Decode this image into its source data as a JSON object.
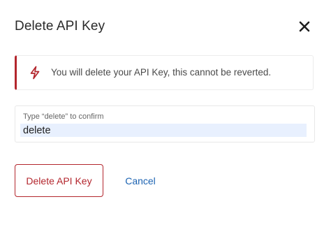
{
  "dialog": {
    "title": "Delete API Key",
    "close_icon": "close-icon"
  },
  "warning": {
    "icon": "lightning-icon",
    "text": "You will delete your API Key, this cannot be reverted.",
    "accent_color": "#b3262d"
  },
  "confirm": {
    "label": "Type “delete” to confirm",
    "value": "delete",
    "autofill_color": "#e8f0fe"
  },
  "actions": {
    "delete_label": "Delete API Key",
    "cancel_label": "Cancel",
    "delete_color": "#b3262d",
    "cancel_color": "#1c63b2"
  }
}
